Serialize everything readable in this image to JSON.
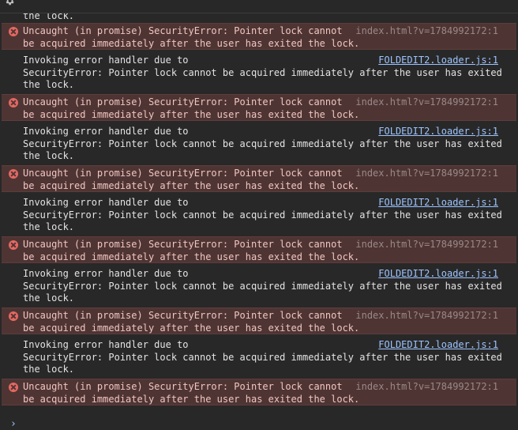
{
  "console": {
    "top_continuation": "the lock.",
    "prompt_glyph": "›",
    "messages": [
      {
        "kind": "error",
        "line1": "Uncaught (in promise) SecurityError: Pointer lock cannot",
        "line2": "be acquired immediately after the user has exited the lock.",
        "source": "index.html?v=1784992172:1"
      },
      {
        "kind": "info",
        "line1": "Invoking error handler due to",
        "line2": "SecurityError: Pointer lock cannot be acquired immediately after the user has exited",
        "line3": "the lock.",
        "source": "FOLDEDIT2.loader.js:1"
      },
      {
        "kind": "error",
        "line1": "Uncaught (in promise) SecurityError: Pointer lock cannot",
        "line2": "be acquired immediately after the user has exited the lock.",
        "source": "index.html?v=1784992172:1"
      },
      {
        "kind": "info",
        "line1": "Invoking error handler due to",
        "line2": "SecurityError: Pointer lock cannot be acquired immediately after the user has exited",
        "line3": "the lock.",
        "source": "FOLDEDIT2.loader.js:1"
      },
      {
        "kind": "error",
        "line1": "Uncaught (in promise) SecurityError: Pointer lock cannot",
        "line2": "be acquired immediately after the user has exited the lock.",
        "source": "index.html?v=1784992172:1"
      },
      {
        "kind": "info",
        "line1": "Invoking error handler due to",
        "line2": "SecurityError: Pointer lock cannot be acquired immediately after the user has exited",
        "line3": "the lock.",
        "source": "FOLDEDIT2.loader.js:1"
      },
      {
        "kind": "error",
        "line1": "Uncaught (in promise) SecurityError: Pointer lock cannot",
        "line2": "be acquired immediately after the user has exited the lock.",
        "source": "index.html?v=1784992172:1"
      },
      {
        "kind": "info",
        "line1": "Invoking error handler due to",
        "line2": "SecurityError: Pointer lock cannot be acquired immediately after the user has exited",
        "line3": "the lock.",
        "source": "FOLDEDIT2.loader.js:1"
      },
      {
        "kind": "error",
        "line1": "Uncaught (in promise) SecurityError: Pointer lock cannot",
        "line2": "be acquired immediately after the user has exited the lock.",
        "source": "index.html?v=1784992172:1"
      },
      {
        "kind": "info",
        "line1": "Invoking error handler due to",
        "line2": "SecurityError: Pointer lock cannot be acquired immediately after the user has exited",
        "line3": "the lock.",
        "source": "FOLDEDIT2.loader.js:1"
      },
      {
        "kind": "error",
        "line1": "Uncaught (in promise) SecurityError: Pointer lock cannot",
        "line2": "be acquired immediately after the user has exited the lock.",
        "source": "index.html?v=1784992172:1"
      }
    ]
  },
  "colors": {
    "background": "#282828",
    "error_bg": "#4e3534",
    "error_text": "#f1c5c1",
    "error_icon": "#e46962",
    "link": "#9cc4ff"
  },
  "icons": {
    "settings": "gear-icon",
    "error": "error-circle-x-icon",
    "prompt": "chevron-right-icon"
  }
}
